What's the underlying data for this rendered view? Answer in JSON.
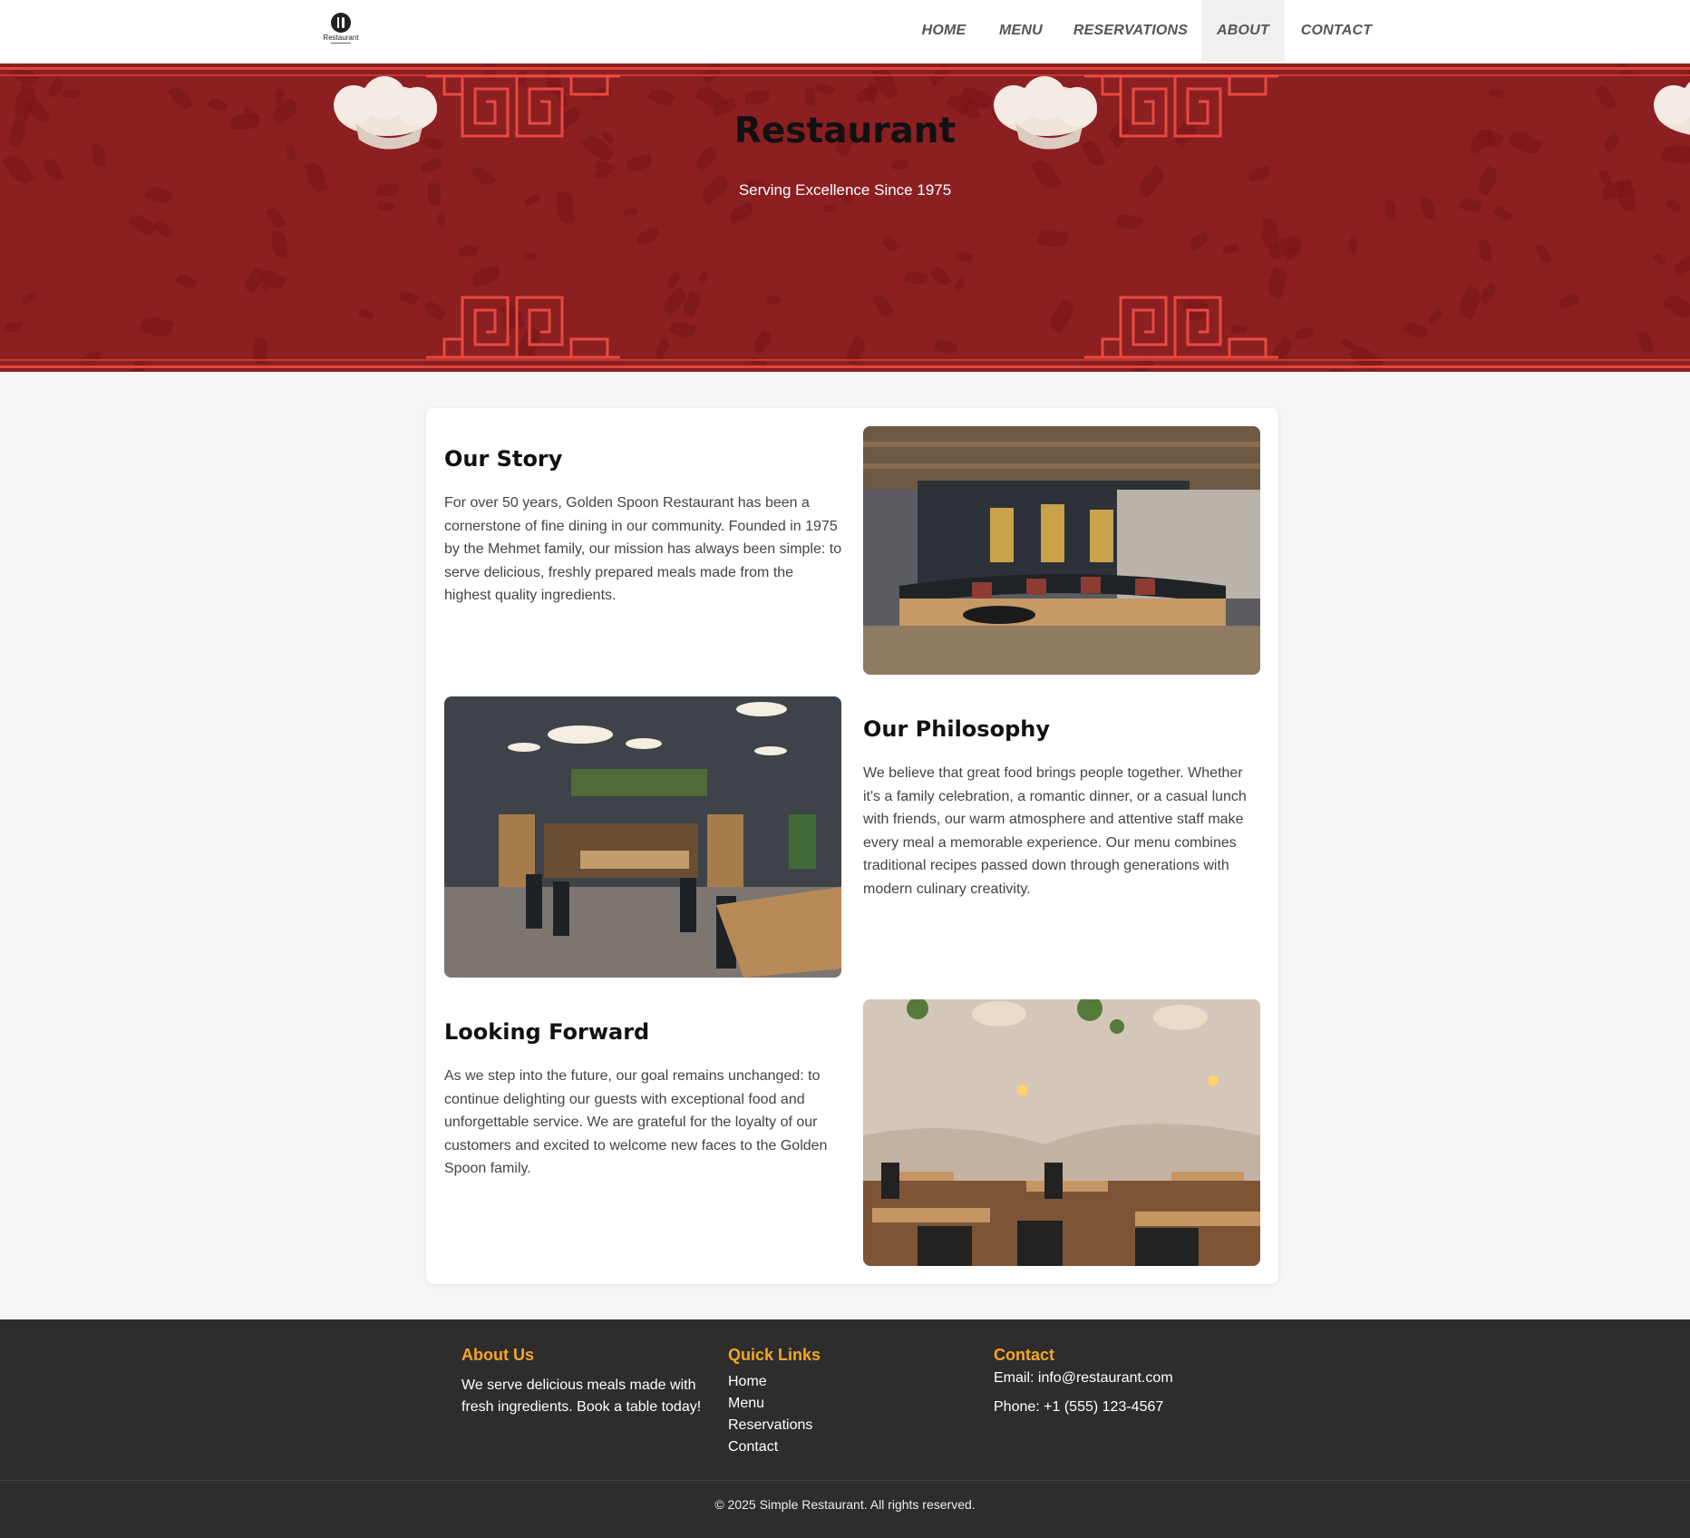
{
  "header": {
    "logo_text": "Restaurant",
    "nav": [
      {
        "label": "HOME"
      },
      {
        "label": "MENU"
      },
      {
        "label": "RESERVATIONS"
      },
      {
        "label": "ABOUT",
        "active": true
      },
      {
        "label": "CONTACT"
      }
    ]
  },
  "hero": {
    "title": "Restaurant",
    "subtitle": "Serving Excellence Since 1975"
  },
  "sections": [
    {
      "title": "Our Story",
      "text": "For over 50 years, Golden Spoon Restaurant has been a cornerstone of fine dining in our community. Founded in 1975 by the Mehmet family, our mission has always been simple: to serve delicious, freshly prepared meals made from the highest quality ingredients.",
      "image": "restaurant bar interior photo"
    },
    {
      "title": "Our Philosophy",
      "text": "We believe that great food brings people together. Whether it's a family celebration, a romantic dinner, or a casual lunch with friends, our warm atmosphere and attentive staff make every meal a memorable experience. Our menu combines traditional recipes passed down through generations with modern culinary creativity.",
      "image": "dining room with pendant lights photo"
    },
    {
      "title": "Looking Forward",
      "text": "As we step into the future, our goal remains unchanged: to continue delighting our guests with exceptional food and unforgettable service. We are grateful for the loyalty of our customers and excited to welcome new faces to the Golden Spoon family.",
      "image": "rustic dining room photo"
    }
  ],
  "footer": {
    "about": {
      "title": "About Us",
      "text": "We serve delicious meals made with fresh ingredients. Book a table today!"
    },
    "links": {
      "title": "Quick Links",
      "items": [
        "Home",
        "Menu",
        "Reservations",
        "Contact"
      ]
    },
    "contact": {
      "title": "Contact",
      "email": "Email: info@restaurant.com",
      "phone": "Phone: +1 (555) 123-4567"
    },
    "copyright": "© 2025 Simple Restaurant. All rights reserved."
  },
  "colors": {
    "hero_red": "#8b1f22",
    "fret_red": "#e0463c",
    "footer_bg": "#2d2d2d",
    "footer_accent": "#f5a623",
    "page_bg": "#f6f6f6"
  }
}
